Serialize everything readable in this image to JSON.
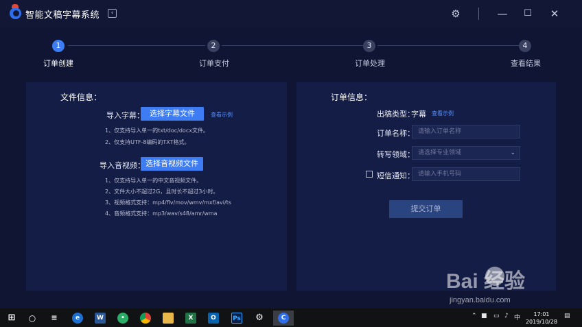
{
  "app": {
    "title": "智能文稿字幕系统"
  },
  "steps": [
    {
      "num": "1",
      "label": "订单创建",
      "active": true
    },
    {
      "num": "2",
      "label": "订单支付",
      "active": false
    },
    {
      "num": "3",
      "label": "订单处理",
      "active": false
    },
    {
      "num": "4",
      "label": "查看结果",
      "active": false
    }
  ],
  "file_info": {
    "title": "文件信息：",
    "subtitle_label": "导入字幕：",
    "subtitle_button": "选择字幕文件",
    "example_link": "查看示例",
    "subtitle_hints": [
      "1、仅支持导入单一的txt/doc/docx文件。",
      "2、仅支持UTF-8编码的TXT格式。"
    ],
    "media_label": "导入音视频：",
    "media_button": "选择音视频文件",
    "media_hints": [
      "1、仅支持导入单一的中文音视频文件。",
      "2、文件大小不超过2G，且时长不超过3小时。",
      "3、视频格式支持：mp4/flv/mov/wmv/mxf/avi/ts",
      "4、音频格式支持：mp3/wav/s48/amr/wma"
    ]
  },
  "order_info": {
    "title": "订单信息：",
    "type_label": "出稿类型：",
    "type_value": "字幕",
    "type_example_link": "查看示例",
    "name_label": "订单名称：",
    "name_placeholder": "请输入订单名称",
    "domain_label": "转写领域：",
    "domain_placeholder": "请选择专业领域",
    "sms_label": "短信通知：",
    "sms_placeholder": "请输入手机号码",
    "submit_label": "提交订单"
  },
  "taskbar": {
    "time": "17:01",
    "date": "2019/10/28",
    "ime": "中",
    "apps": [
      "start",
      "cortana",
      "task-view",
      "edge",
      "word",
      "wechat",
      "chrome",
      "file-explorer",
      "excel",
      "outlook",
      "photoshop",
      "settings",
      "subtitle-app"
    ]
  },
  "watermark": {
    "brand": "Bai  经验",
    "url": "jingyan.baidu.com"
  },
  "colors": {
    "accent": "#3d7cf3",
    "background": "#0f1533",
    "panel": "#141d45",
    "submit_disabled": "#2a4480"
  }
}
